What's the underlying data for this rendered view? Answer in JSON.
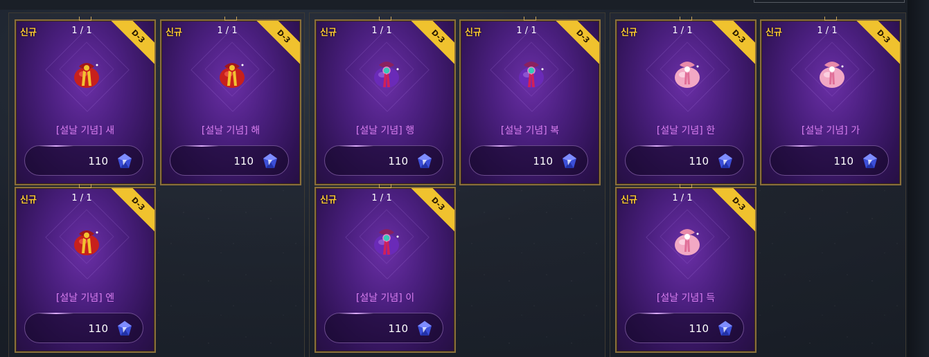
{
  "cards": [
    {
      "badge": "신규",
      "count": "1 / 1",
      "ribbon": "D-3",
      "title": "[설날 기념] 새",
      "price": "110",
      "icon": "red-lucky-bag-icon",
      "color": "red"
    },
    {
      "badge": "신규",
      "count": "1 / 1",
      "ribbon": "D-3",
      "title": "[설날 기념] 해",
      "price": "110",
      "icon": "red-lucky-bag-icon",
      "color": "red"
    },
    {
      "badge": "신규",
      "count": "1 / 1",
      "ribbon": "D-3",
      "title": "[설날 기념] 행",
      "price": "110",
      "icon": "purple-lucky-bag-icon",
      "color": "purple"
    },
    {
      "badge": "신규",
      "count": "1 / 1",
      "ribbon": "D-3",
      "title": "[설날 기념] 복",
      "price": "110",
      "icon": "purple-lucky-bag-icon",
      "color": "purple"
    },
    {
      "badge": "신규",
      "count": "1 / 1",
      "ribbon": "D-3",
      "title": "[설날 기념] 한",
      "price": "110",
      "icon": "pink-lucky-bag-icon",
      "color": "pink"
    },
    {
      "badge": "신규",
      "count": "1 / 1",
      "ribbon": "D-3",
      "title": "[설날 기념] 가",
      "price": "110",
      "icon": "pink-lucky-bag-icon",
      "color": "pink"
    },
    {
      "badge": "신규",
      "count": "1 / 1",
      "ribbon": "D-3",
      "title": "[설날 기념] 엔",
      "price": "110",
      "icon": "red-lucky-bag-icon",
      "color": "red"
    },
    {
      "badge": "신규",
      "count": "1 / 1",
      "ribbon": "D-3",
      "title": "[설날 기념] 이",
      "price": "110",
      "icon": "purple-lucky-bag-icon",
      "color": "purple"
    },
    {
      "badge": "신규",
      "count": "1 / 1",
      "ribbon": "D-3",
      "title": "[설날 기념] 득",
      "price": "110",
      "icon": "pink-lucky-bag-icon",
      "color": "pink"
    }
  ],
  "currency_icon": "blue-crystal-gem-icon",
  "colors": {
    "badge": "#ffcc33",
    "ribbon": "#f0c22e",
    "title": "#d97ef0",
    "card_border": "#8a6f3c"
  }
}
